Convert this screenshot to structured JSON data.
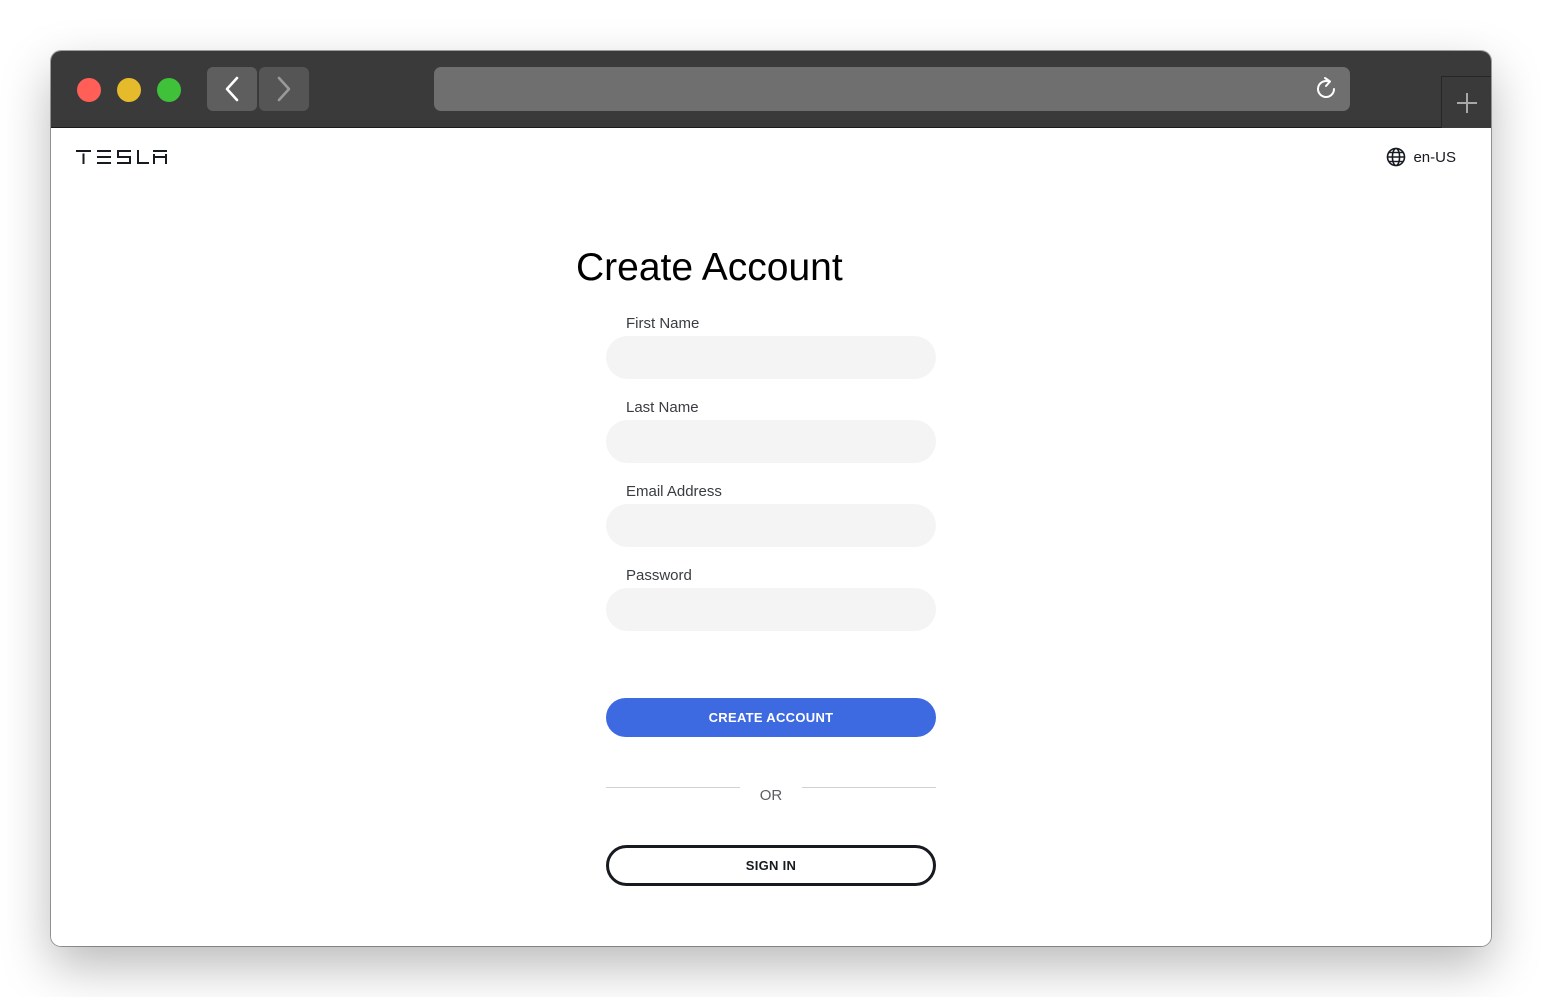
{
  "browser": {
    "traffic_lights": [
      "close",
      "minimize",
      "zoom"
    ],
    "back_icon": "chevron-left-icon",
    "forward_icon": "chevron-right-icon",
    "reload_icon": "reload-icon",
    "new_tab_icon": "plus-icon",
    "url": ""
  },
  "header": {
    "logo_alt": "TESLA",
    "language": "en-US",
    "language_icon": "globe-icon"
  },
  "main": {
    "title": "Create Account",
    "fields": [
      {
        "label": "First Name",
        "value": ""
      },
      {
        "label": "Last Name",
        "value": ""
      },
      {
        "label": "Email Address",
        "value": ""
      },
      {
        "label": "Password",
        "value": ""
      }
    ],
    "create_button": "CREATE ACCOUNT",
    "divider_text": "OR",
    "sign_in_button": "SIGN IN"
  },
  "colors": {
    "primary": "#3e6ae1",
    "titlebar": "#3a3a3a",
    "input_bg": "#f4f4f4",
    "text_dark": "#171a20"
  }
}
